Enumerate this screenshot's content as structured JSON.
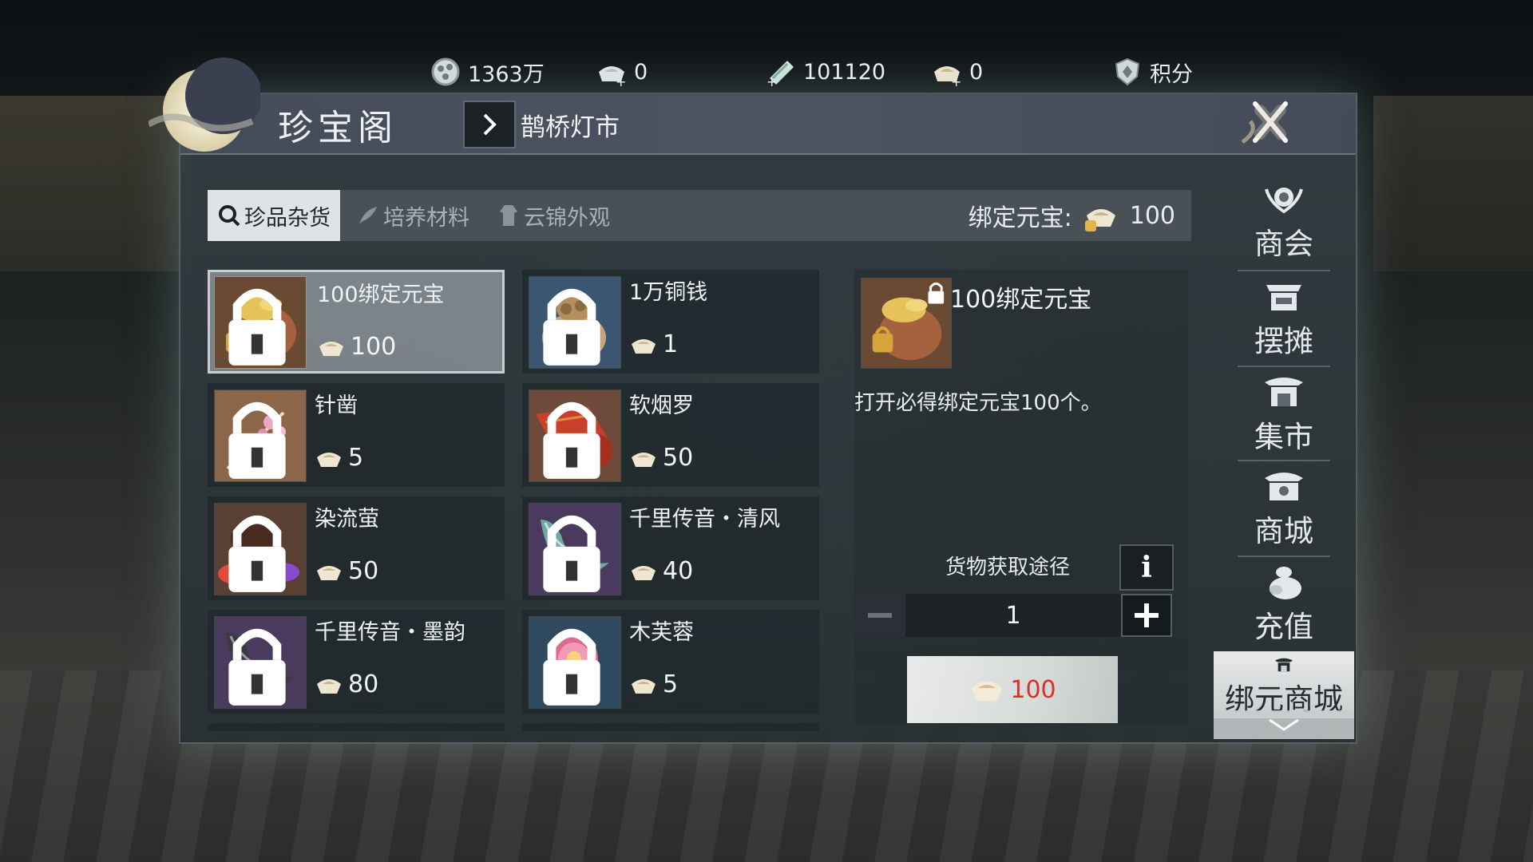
{
  "currencies": [
    {
      "icon": "copper-coin-icon",
      "value": "1363万"
    },
    {
      "icon": "ingot-plus-icon",
      "value": "0"
    },
    {
      "icon": "jade-ticket-plus-icon",
      "value": "101120"
    },
    {
      "icon": "gold-ingot-plus-icon",
      "value": "0"
    },
    {
      "icon": "shield-points-icon",
      "value": "积分"
    }
  ],
  "window": {
    "title": "珍宝阁",
    "breadcrumb": "鹊桥灯市"
  },
  "tabs": [
    {
      "label": "珍品杂货",
      "icon": "magnifier-icon",
      "active": true
    },
    {
      "label": "培养材料",
      "icon": "feather-icon",
      "active": false
    },
    {
      "label": "云锦外观",
      "icon": "robe-icon",
      "active": false
    }
  ],
  "bound_balance": {
    "label": "绑定元宝:",
    "value": "100"
  },
  "items": [
    {
      "name": "100绑定元宝",
      "price": "100",
      "art": "ingot-bag"
    },
    {
      "name": "1万铜钱",
      "price": "1",
      "art": "coin-sack"
    },
    {
      "name": "针凿",
      "price": "5",
      "art": "needle"
    },
    {
      "name": "软烟罗",
      "price": "50",
      "art": "silk-roll"
    },
    {
      "name": "染流萤",
      "price": "50",
      "art": "dye-pot"
    },
    {
      "name": "千里传音・清风",
      "price": "40",
      "art": "horn-teal"
    },
    {
      "name": "千里传音・墨韵",
      "price": "80",
      "art": "horn-ink"
    },
    {
      "name": "木芙蓉",
      "price": "5",
      "art": "flower"
    }
  ],
  "detail": {
    "name": "100绑定元宝",
    "description": "打开必得绑定元宝100个。",
    "acquire_label": "货物获取途径",
    "info_glyph": "i",
    "quantity": "1",
    "buy_price": "100"
  },
  "side_nav": [
    {
      "label": "商会",
      "icon": "guild-emblem-icon"
    },
    {
      "label": "摆摊",
      "icon": "stall-icon"
    },
    {
      "label": "集市",
      "icon": "market-icon"
    },
    {
      "label": "商城",
      "icon": "mall-icon"
    },
    {
      "label": "充值",
      "icon": "money-bag-icon"
    },
    {
      "label": "绑元商城",
      "icon": "bound-shop-icon"
    }
  ],
  "colors": {
    "price_red": "#d8302a",
    "panel": "#2a3236",
    "selected": "#9aa1a6"
  }
}
